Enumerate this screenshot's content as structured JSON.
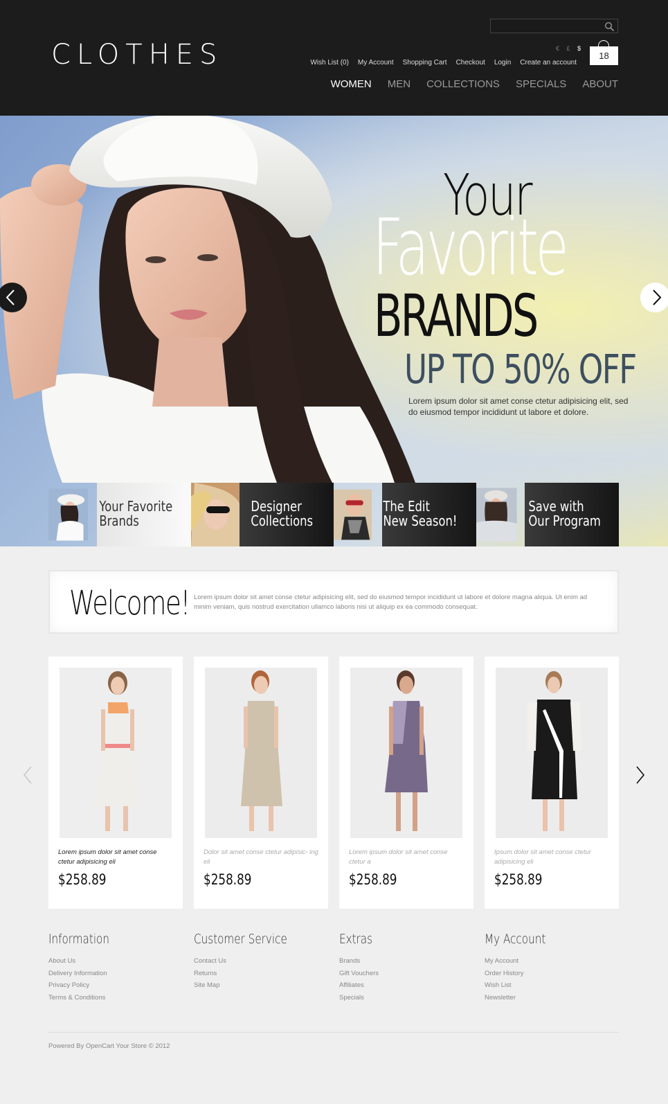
{
  "header": {
    "logo": "CLOTHES",
    "currency": {
      "euro": "€",
      "pound": "£",
      "dollar": "$"
    },
    "cart_count": "18",
    "top_links": [
      "Wish List (0)",
      "My Account",
      "Shopping Cart",
      "Checkout",
      "Login",
      "Create an account"
    ],
    "nav": [
      "WOMEN",
      "MEN",
      "COLLECTIONS",
      "SPECIALS",
      "ABOUT"
    ]
  },
  "hero": {
    "line1": "Your",
    "line2": "Favorite",
    "line3": "BRANDS",
    "line4": "UP TO 50% OFF",
    "desc": "Lorem ipsum dolor sit amet conse ctetur adipisicing elit, sed do eiusmod tempor incididunt ut labore et dolore."
  },
  "banners": [
    {
      "line1": "Your Favorite",
      "line2": "Brands"
    },
    {
      "line1": "Designer",
      "line2": "Collections"
    },
    {
      "line1": "The Edit",
      "line2": "New Season!"
    },
    {
      "line1": "Save with",
      "line2": "Our Program"
    }
  ],
  "welcome": {
    "title": "Welcome!",
    "text": "Lorem ipsum dolor sit amet conse ctetur adipisicing elit, sed do eiusmod tempor incididunt ut labore et dolore magna aliqua. Ut enim ad minim veniam, quis nostrud exercitation ullamco laboris nisi ut aliquip ex ea commodo consequat."
  },
  "products": [
    {
      "desc": "Lorem ipsum dolor sit amet conse ctetur adipisicing eli",
      "price": "$258.89"
    },
    {
      "desc": "Dolor sit amet conse ctetur adipisic- ing eli",
      "price": "$258.89"
    },
    {
      "desc": "Lorem ipsum dolor sit amet conse ctetur a",
      "price": "$258.89"
    },
    {
      "desc": "Ipsum dolor sit amet conse ctetur adipisicing eli",
      "price": "$258.89"
    }
  ],
  "footer": {
    "columns": [
      {
        "title": "Information",
        "links": [
          "About Us",
          "Delivery Information",
          "Privacy Policy",
          "Terms & Conditions"
        ]
      },
      {
        "title": "Customer Service",
        "links": [
          "Contact Us",
          "Returns",
          "Site Map"
        ]
      },
      {
        "title": "Extras",
        "links": [
          "Brands",
          "Gift Vouchers",
          "Affiliates",
          "Specials"
        ]
      },
      {
        "title": "My Account",
        "links": [
          "My Account",
          "Order History",
          "Wish List",
          "Newsletter"
        ]
      }
    ],
    "powered": "Powered By OpenCart Your Store © 2012"
  },
  "colors": {
    "header_bg": "#1c1c1c",
    "page_bg": "#efefef",
    "accent_text": "#3d4f60"
  }
}
